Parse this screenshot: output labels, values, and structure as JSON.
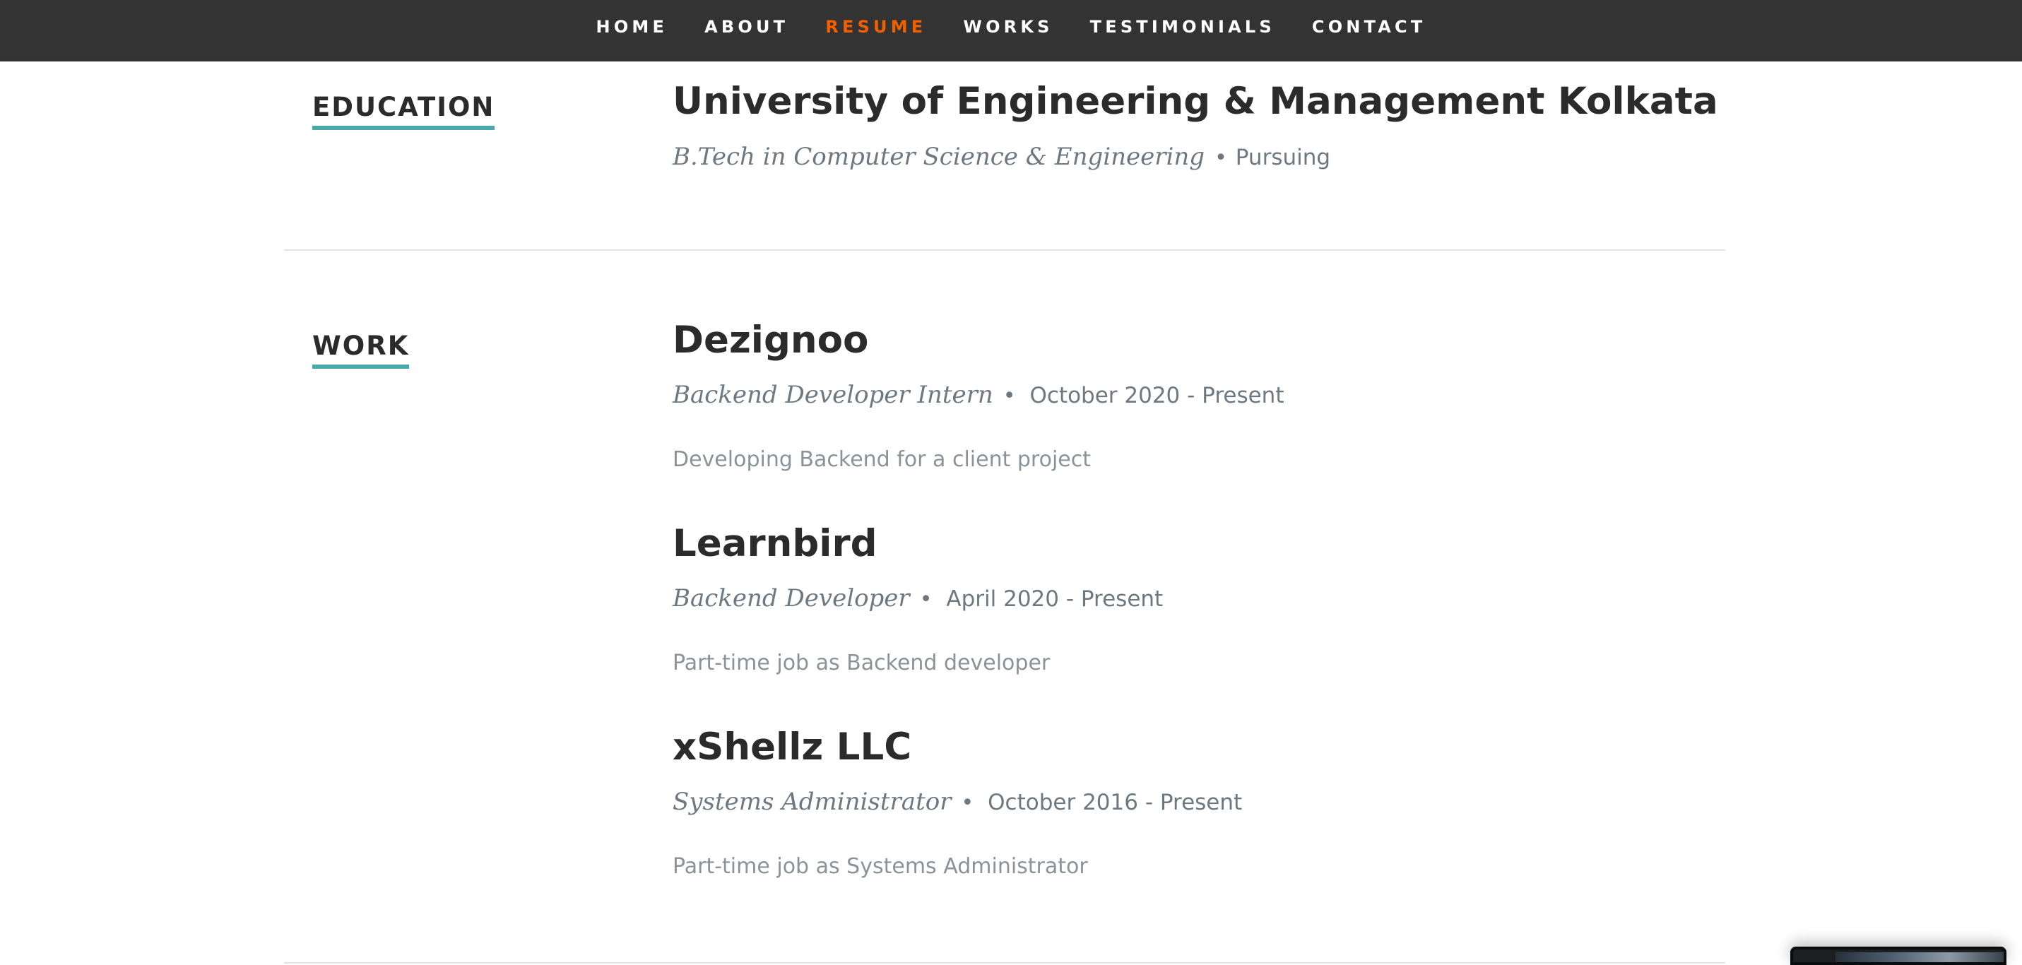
{
  "nav": {
    "items": [
      {
        "label": "HOME",
        "current": false
      },
      {
        "label": "ABOUT",
        "current": false
      },
      {
        "label": "RESUME",
        "current": true
      },
      {
        "label": "WORKS",
        "current": false
      },
      {
        "label": "TESTIMONIALS",
        "current": false
      },
      {
        "label": "CONTACT",
        "current": false
      }
    ],
    "accent_color": "#F06000",
    "background": "#333333"
  },
  "education": {
    "heading": "EDUCATION",
    "entries": [
      {
        "school": "University of Engineering & Management Kolkata",
        "degree": "B.Tech in Computer Science & Engineering",
        "bullet": "•",
        "status": "Pursuing"
      }
    ]
  },
  "work": {
    "heading": "WORK",
    "entries": [
      {
        "company": "Dezignoo",
        "role": "Backend Developer Intern",
        "bullet": "•",
        "period": "October 2020 - Present",
        "description": "Developing Backend for a client project"
      },
      {
        "company": "Learnbird",
        "role": "Backend Developer",
        "bullet": "•",
        "period": "April 2020 - Present",
        "description": "Part-time job as Backend developer"
      },
      {
        "company": "xShellz LLC",
        "role": "Systems Administrator",
        "bullet": "•",
        "period": "October 2016 - Present",
        "description": "Part-time job as Systems Administrator"
      }
    ]
  },
  "colors": {
    "heading_underline": "#4aa9aa",
    "title_text": "#2b2b2b",
    "meta_text": "#6e7881"
  }
}
